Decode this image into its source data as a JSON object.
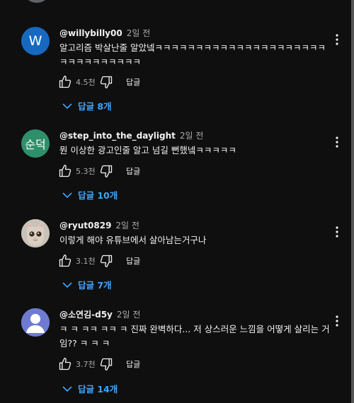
{
  "comments": [
    {
      "avatar_text": "W",
      "username": "@willybilly00",
      "time": "2일 전",
      "text": "알고리즘 박살난줄 알았넼ㅋㅋㅋㅋㅋㅋㅋㅋㅋㅋㅋㅋㅋㅋㅋㅋㅋㅋㅋㅋㅋㅋㅋㅋㅋㅋㅋㅋㅋㅋㅋ",
      "likes": "4.5천",
      "reply_label": "답글",
      "replies_label": "답글 8개"
    },
    {
      "avatar_text": "순덕",
      "username": "@step_into_the_daylight",
      "time": "2일 전",
      "text": "뭔 이상한 광고인줄 알고 넘길 뻔했넼ㅋㅋㅋㅋㅋ",
      "likes": "5.3천",
      "reply_label": "답글",
      "replies_label": "답글 10개"
    },
    {
      "avatar_text": "",
      "username": "@ryut0829",
      "time": "2일 전",
      "text": "이렇게 해야 유튜브에서 살아남는거구나",
      "likes": "3.1천",
      "reply_label": "답글",
      "replies_label": "답글 7개"
    },
    {
      "avatar_text": "",
      "username": "@소연김-d5y",
      "time": "2일 전",
      "text": "ㅋ ㅋ ㅋㅋ  ㅋㅋ ㅋ 진짜 완벽하다... 저 상스러운 느낌을 어떻게 살리는 거임?? ㅋ ㅋ  ㅋ",
      "likes": "3.7천",
      "reply_label": "답글",
      "replies_label": "답글 14개"
    }
  ],
  "icons": {
    "like": "thumb-up-icon",
    "dislike": "thumb-down-icon",
    "more": "more-vert-icon",
    "expand": "chevron-down-icon"
  },
  "colors": {
    "background": "#0f0f0f",
    "link": "#3ea6ff",
    "avatar_w": "#1769c0",
    "avatar_sd": "#2f8f6b",
    "avatar_user": "#6e7bd1"
  }
}
